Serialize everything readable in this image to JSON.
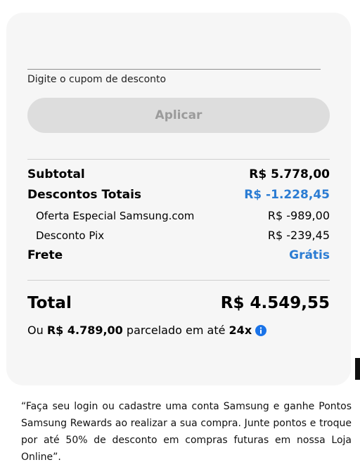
{
  "coupon": {
    "placeholder": "Digite o cupom de desconto",
    "apply_label": "Aplicar"
  },
  "summary": {
    "subtotal_label": "Subtotal",
    "subtotal_value": "R$ 5.778,00",
    "discounts_label": "Descontos Totais",
    "discounts_value": "R$ -1.228,45",
    "offer_label": "Oferta Especial Samsung.com",
    "offer_value": "R$ -989,00",
    "pix_label": "Desconto Pix",
    "pix_value": "R$ -239,45",
    "shipping_label": "Frete",
    "shipping_value": "Grátis",
    "total_label": "Total",
    "total_value": "R$ 4.549,55"
  },
  "installments": {
    "prefix": "Ou",
    "amount": "R$ 4.789,00",
    "middle": "parcelado em até",
    "count": "24x",
    "icon": "info-icon"
  },
  "note": "“Faça seu login ou cadastre uma conta Samsung e ganhe Pontos Samsung Rewards ao realizar a sua compra. Junte pontos e troque por até 50% de desconto em compras futuras em nossa Loja Online”.",
  "colors": {
    "accent_blue": "#2b7cd3",
    "card_bg": "#f6f6f6",
    "button_bg": "#dddddd"
  }
}
